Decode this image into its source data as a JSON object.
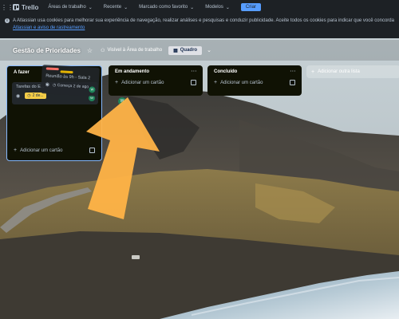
{
  "topnav": {
    "app_name": "Trello",
    "menus": [
      {
        "label": "Áreas de trabalho"
      },
      {
        "label": "Recente"
      },
      {
        "label": "Marcado como favorito"
      },
      {
        "label": "Modelos"
      }
    ],
    "create_label": "Criar"
  },
  "cookie_banner": {
    "text": "A Atlassian usa cookies para melhorar sua experiência de navegação, realizar análises e pesquisas e conduzir publicidade. Aceite todos os cookies para indicar que você concorda com",
    "link": "Atlassian e aviso de rastreamento"
  },
  "board": {
    "title": "Gestão de Prioridades",
    "visibility": "Visível à Área de trabalho",
    "view_label": "Quadro"
  },
  "lists": [
    {
      "title": "A fazer",
      "add_card": "Adicionar um cartão"
    },
    {
      "title": "Em andamento",
      "add_card": "Adicionar um cartão"
    },
    {
      "title": "Concluído",
      "add_card": "Adicionar um cartão"
    }
  ],
  "add_list_label": "Adicionar outra lista",
  "cards": {
    "todo_card": {
      "title": "Tarefas do E...",
      "due": "2 de...",
      "avatar": "W"
    },
    "dragged_card": {
      "title": "Reunião às 9h - Sala 2",
      "start": "Começa 2 de ago",
      "avatar": "W"
    }
  },
  "doing_avatar": "W",
  "colors": {
    "topbar": "#1d2125",
    "list_bg": "#101204",
    "card_bg": "#22272b",
    "accent_blue": "#579dff",
    "due_yellow": "#f5cd47",
    "arrow": "#ffb347"
  }
}
